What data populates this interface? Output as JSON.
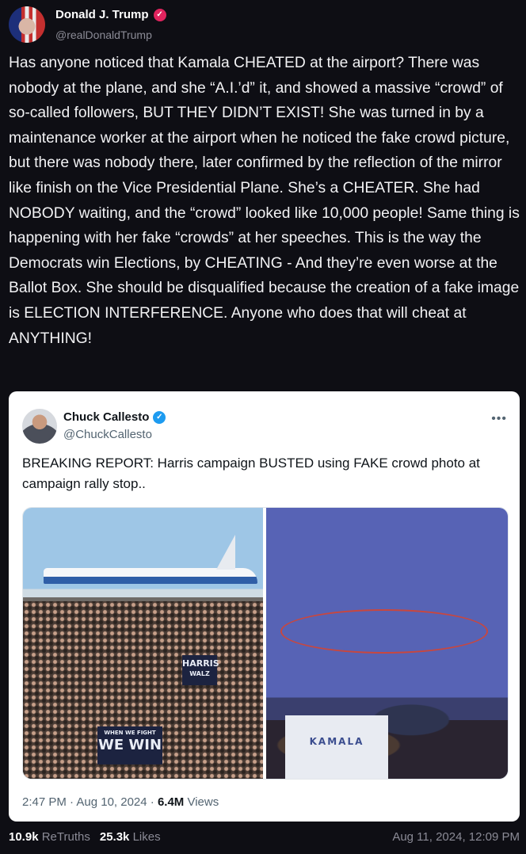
{
  "author": {
    "name": "Donald J. Trump",
    "handle": "@realDonaldTrump",
    "verified_color": "#e0245e"
  },
  "post_text": "Has anyone noticed that Kamala CHEATED at the airport? There was nobody at the plane, and she “A.I.’d” it, and showed a massive “crowd” of so-called followers, BUT THEY DIDN’T EXIST! She was turned in by a maintenance worker at the airport when he noticed the fake crowd picture, but there was nobody there, later confirmed by the reflection of the mirror like finish on the Vice Presidential Plane. She’s a CHEATER. She had NOBODY waiting, and the “crowd” looked like 10,000 people! Same thing is happening with her fake “crowds” at her speeches. This is the way the Democrats win Elections, by CHEATING - And they’re even worse at the Ballot Box. She should be disqualified because the creation of a fake image is ELECTION INTERFERENCE. Anyone who does that will cheat at ANYTHING!",
  "embedded": {
    "name": "Chuck Callesto",
    "handle": "@ChuckCallesto",
    "more_icon": "•••",
    "text": "BREAKING REPORT: Harris campaign BUSTED using FAKE crowd photo at campaign rally stop..",
    "images": {
      "left_signs": {
        "harris": "HARRIS",
        "walz": "WALZ",
        "when_we_fight": "WHEN WE FIGHT",
        "we_win": "WE WIN"
      },
      "right_sign": "KAMALA"
    },
    "meta_time": "2:47 PM · Aug 10, 2024 · ",
    "meta_views": "6.4M",
    "meta_views_label": " Views"
  },
  "stats": {
    "retruths_count": "10.9k",
    "retruths_label": "ReTruths",
    "likes_count": "25.3k",
    "likes_label": "Likes"
  },
  "timestamp": "Aug 11, 2024, 12:09 PM"
}
